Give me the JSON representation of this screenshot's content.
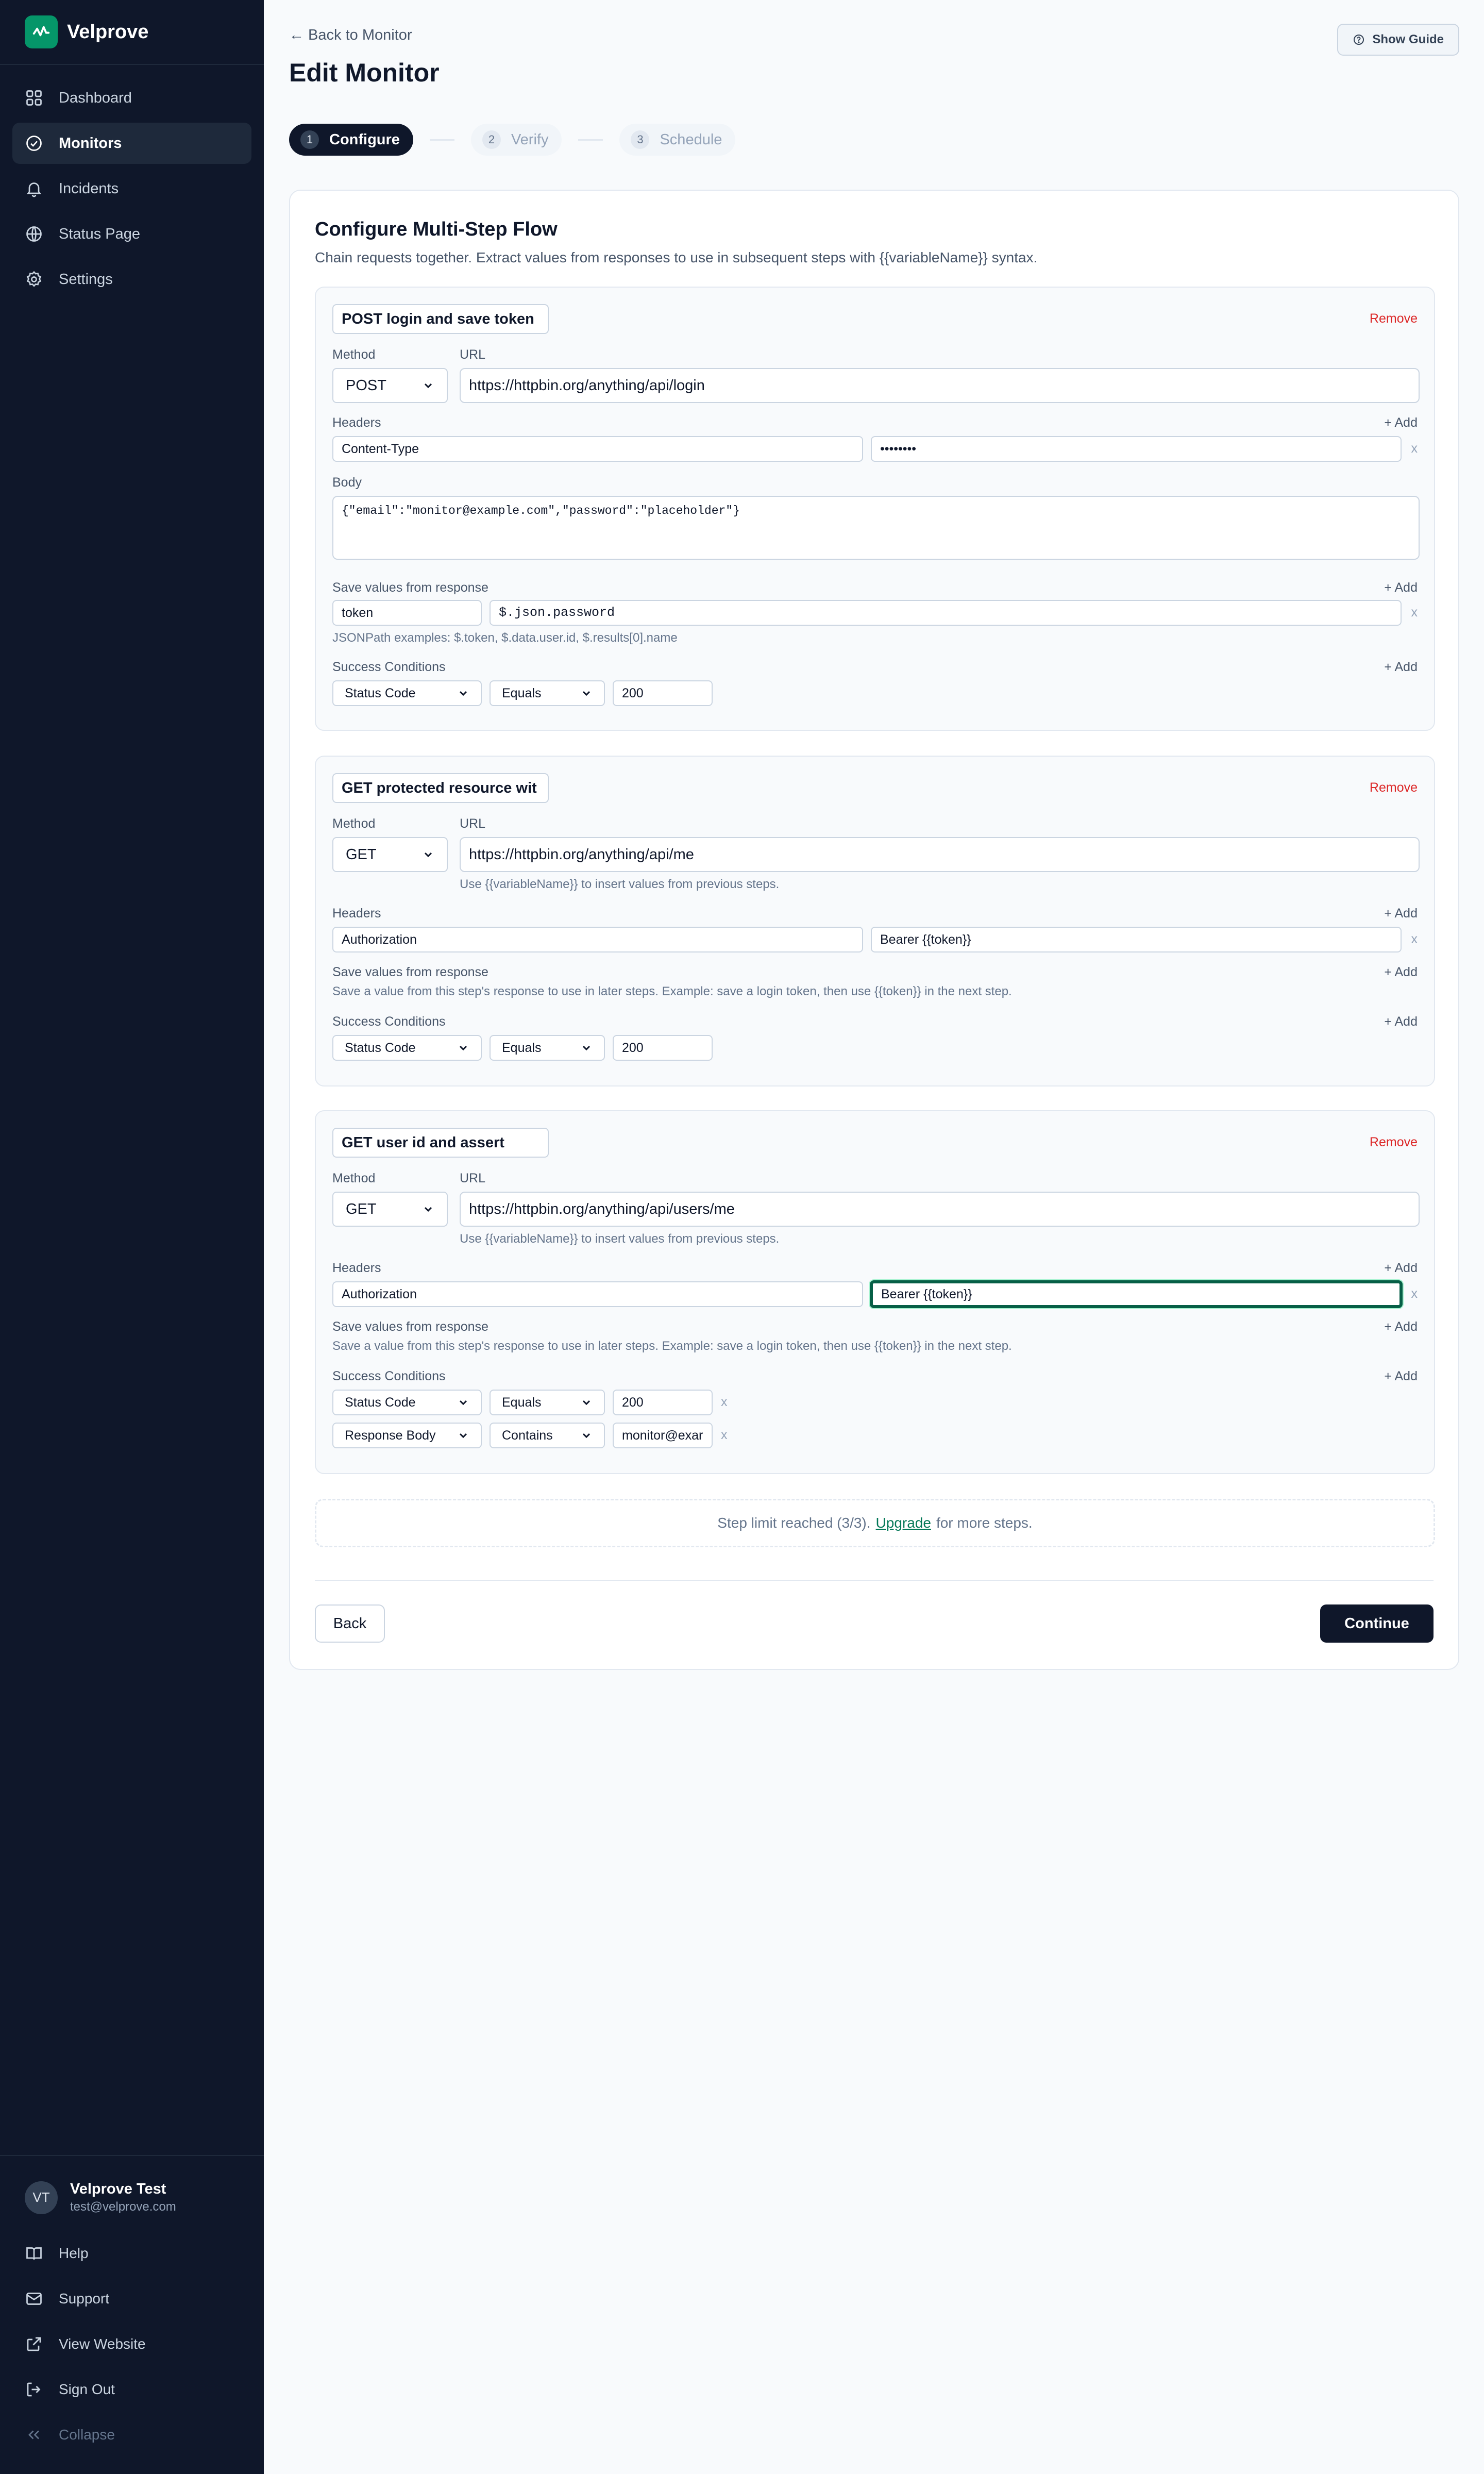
{
  "sidebar": {
    "brand": "Velprove",
    "nav": [
      {
        "label": "Dashboard",
        "icon": "grid-icon",
        "active": false
      },
      {
        "label": "Monitors",
        "icon": "check-circle-icon",
        "active": true
      },
      {
        "label": "Incidents",
        "icon": "bell-icon",
        "active": false
      },
      {
        "label": "Status Page",
        "icon": "globe-icon",
        "active": false
      },
      {
        "label": "Settings",
        "icon": "gear-icon",
        "active": false
      }
    ],
    "user": {
      "initials": "VT",
      "name": "Velprove Test",
      "email": "test@velprove.com"
    },
    "footer_links": [
      "Help",
      "Support",
      "View Website",
      "Sign Out",
      "Collapse"
    ]
  },
  "header": {
    "back_label": "← Back to Monitor",
    "title": "Edit Monitor",
    "guide_button": "Show Guide"
  },
  "wizard": [
    {
      "num": "1",
      "label": "Configure",
      "active": true
    },
    {
      "num": "2",
      "label": "Verify",
      "active": false
    },
    {
      "num": "3",
      "label": "Schedule",
      "active": false
    }
  ],
  "card": {
    "title": "Configure Multi-Step Flow",
    "description": "Chain requests together. Extract values from responses to use in subsequent steps with {{variableName}} syntax."
  },
  "labels": {
    "method": "Method",
    "url": "URL",
    "headers": "Headers",
    "body": "Body",
    "save_values": "Save values from response",
    "success_conditions": "Success Conditions",
    "add": "+ Add",
    "remove": "Remove",
    "x": "x",
    "url_hint": "Use {{variableName}} to insert values from previous steps.",
    "save_hint": "Save a value from this step's response to use in later steps. Example: save a login token, then use {{token}} in the next step.",
    "jsonpath_hint": "JSONPath examples: $.token, $.data.user.id, $.results[0].name"
  },
  "steps": [
    {
      "name": "POST login and save token",
      "method": "POST",
      "url": "https://httpbin.org/anything/api/login",
      "header_key": "Content-Type",
      "header_value": "••••••••",
      "body": "{\"email\":\"monitor@example.com\",\"password\":\"placeholder\"}",
      "save_var": "token",
      "save_path": "$.json.password",
      "conditions": [
        {
          "type": "Status Code",
          "op": "Equals",
          "value": "200"
        }
      ]
    },
    {
      "name": "GET protected resource wit",
      "method": "GET",
      "url": "https://httpbin.org/anything/api/me",
      "header_key": "Authorization",
      "header_value": "Bearer {{token}}",
      "conditions": [
        {
          "type": "Status Code",
          "op": "Equals",
          "value": "200"
        }
      ]
    },
    {
      "name": "GET user id and assert matc",
      "method": "GET",
      "url": "https://httpbin.org/anything/api/users/me",
      "header_key": "Authorization",
      "header_value": "Bearer {{token}}",
      "conditions": [
        {
          "type": "Status Code",
          "op": "Equals",
          "value": "200"
        },
        {
          "type": "Response Body",
          "op": "Contains",
          "value": "monitor@exar"
        }
      ]
    }
  ],
  "limit": {
    "prefix": "Step limit reached (3/3).",
    "link": "Upgrade",
    "suffix": "for more steps."
  },
  "footer": {
    "back": "Back",
    "continue": "Continue"
  },
  "colors": {
    "sidebar_bg": "#0f172a",
    "brand_green": "#059669",
    "danger": "#dc2626",
    "focus_ring": "#065f46"
  }
}
